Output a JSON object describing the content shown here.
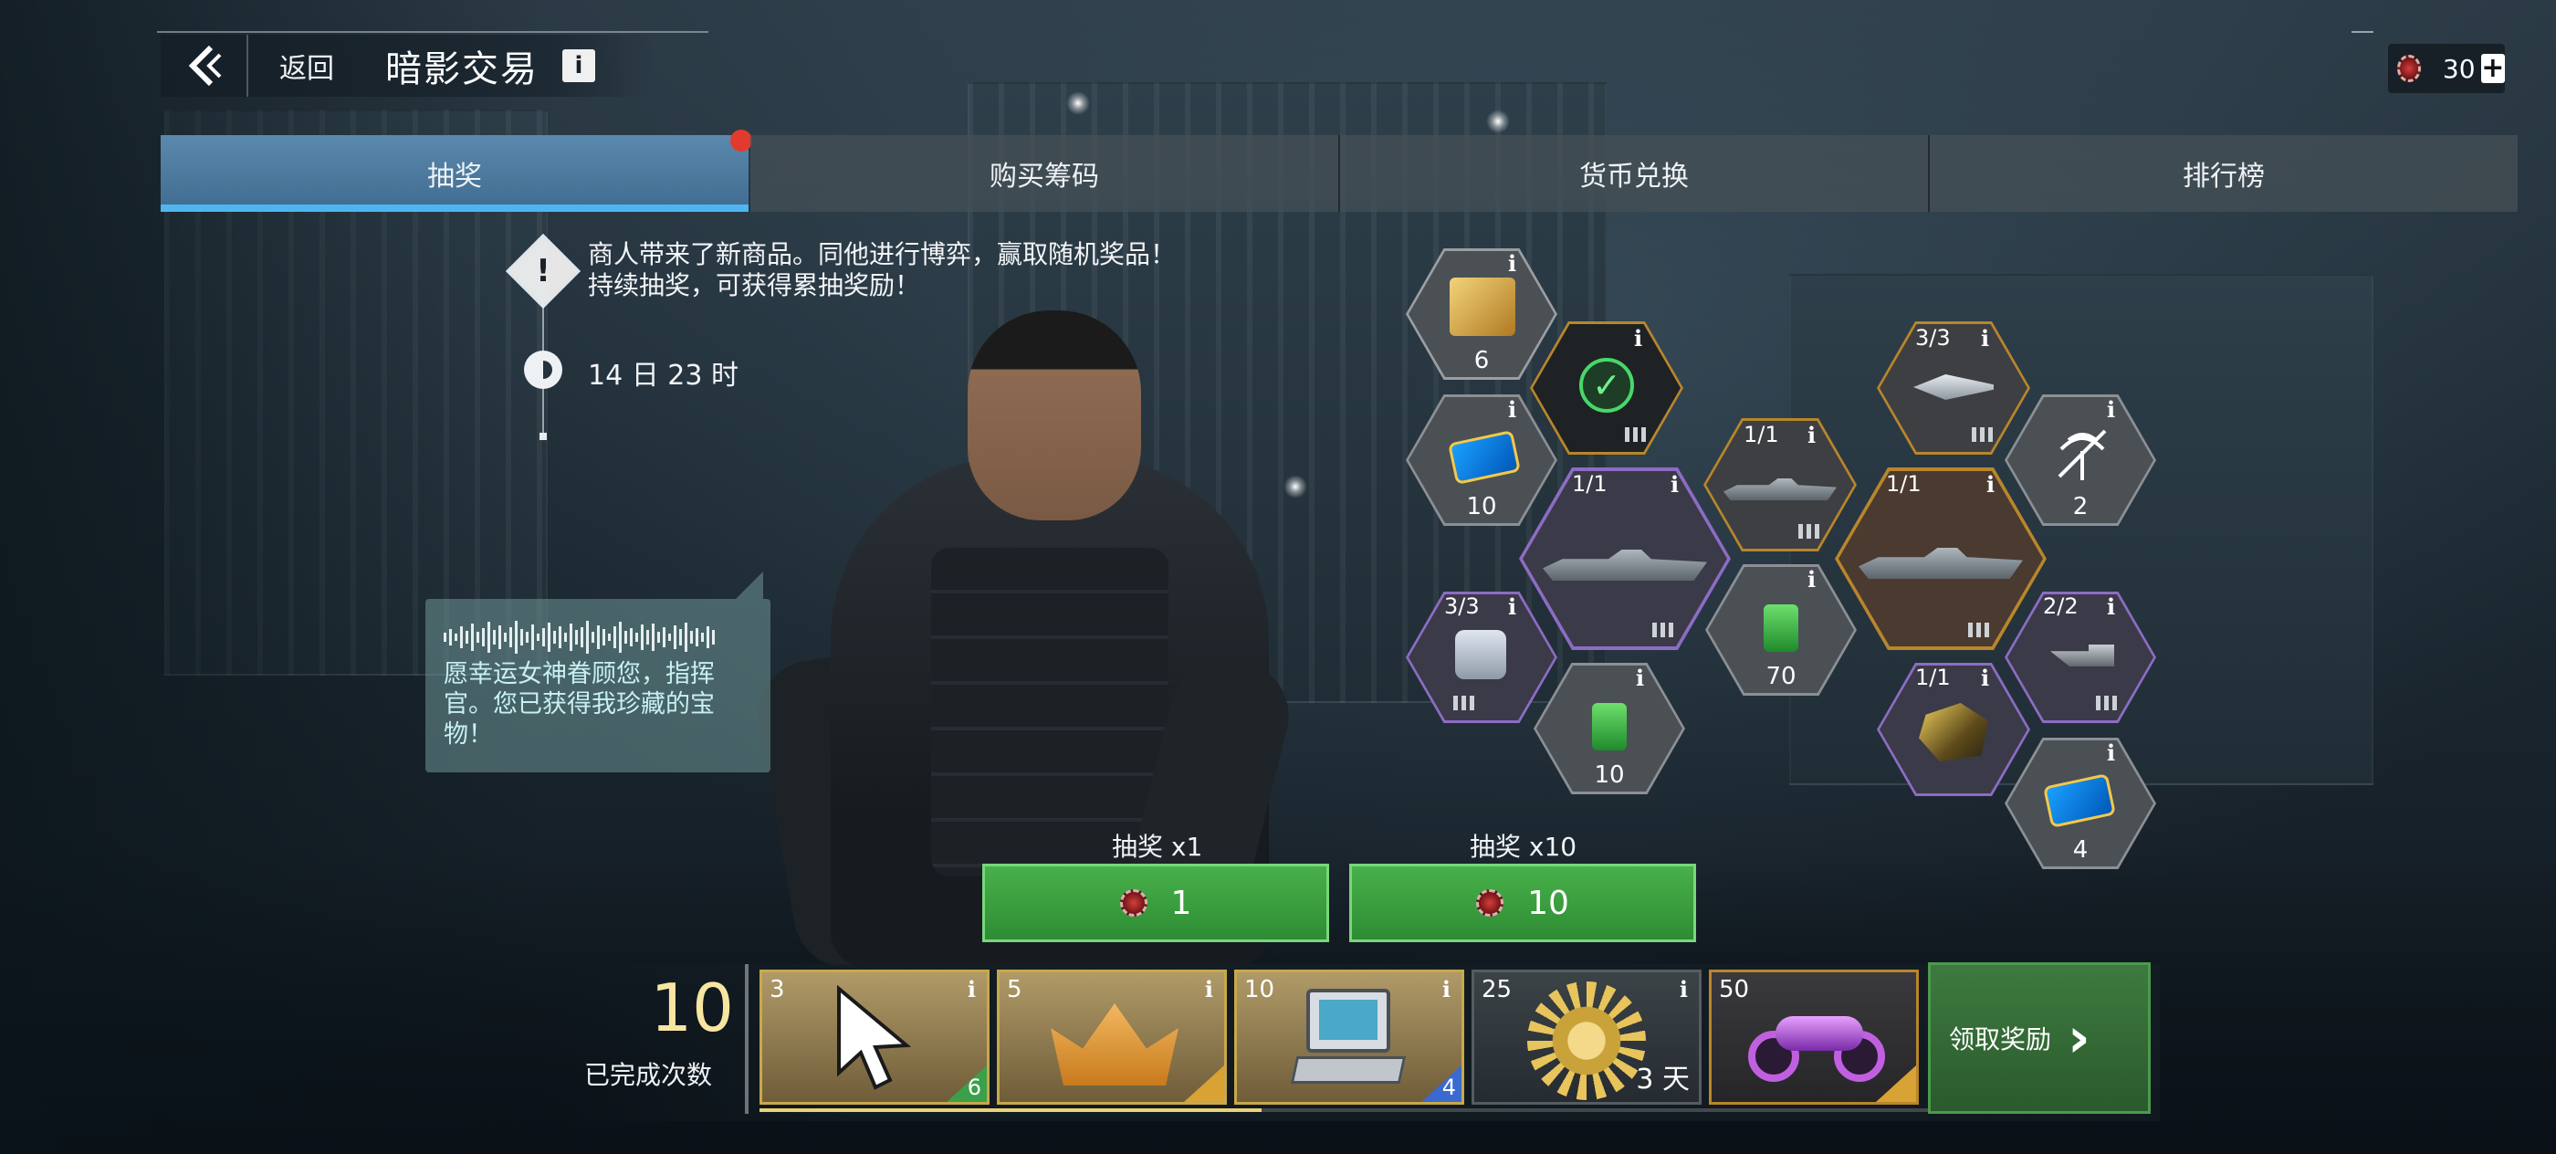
{
  "header": {
    "back_label": "返回",
    "title": "暗影交易",
    "info_glyph": "i",
    "currency_value": "30",
    "plus_glyph": "+"
  },
  "tabs": [
    {
      "label": "抽奖",
      "active": true,
      "badge": true
    },
    {
      "label": "购买筹码",
      "active": false
    },
    {
      "label": "货币兑换",
      "active": false
    },
    {
      "label": "排行榜",
      "active": false
    }
  ],
  "event": {
    "desc_line1": "商人带来了新商品。同他进行博弈，赢取随机奖品！",
    "desc_line2": "持续抽奖，可获得累抽奖励！",
    "timer": "14 日 23 时"
  },
  "speech": {
    "text": "愿幸运女神眷顾您，指挥官。您已获得我珍藏的宝物！"
  },
  "prizes": [
    {
      "id": "gear",
      "label": "6",
      "icon": "gear-crosshair-icon",
      "rarity": "gold"
    },
    {
      "id": "ship-claimed",
      "label": "",
      "icon": "check-icon",
      "rarity": "gold",
      "tier": "III",
      "claimed": true
    },
    {
      "id": "ticket-a",
      "label": "10",
      "icon": "ticket-icon",
      "rarity": "grey"
    },
    {
      "id": "ship-big-a",
      "tl": "1/1",
      "icon": "warship-icon",
      "rarity": "purple",
      "tier": "III"
    },
    {
      "id": "ship-mid",
      "tl": "1/1",
      "icon": "warship-icon",
      "rarity": "gold",
      "tier": "III"
    },
    {
      "id": "jet",
      "tl": "3/3",
      "icon": "aircraft-icon",
      "rarity": "gold",
      "tier": "III"
    },
    {
      "id": "signal",
      "label": "2",
      "icon": "signal-off-icon",
      "rarity": "grey"
    },
    {
      "id": "ship-big-b",
      "tl": "1/1",
      "icon": "warship-icon",
      "rarity": "gold",
      "tier": "III"
    },
    {
      "id": "module",
      "tl": "3/3",
      "icon": "module-icon",
      "rarity": "purple",
      "tier": "III"
    },
    {
      "id": "chip-70",
      "label": "70",
      "icon": "upgrade-chip-icon",
      "rarity": "grey"
    },
    {
      "id": "chip-10",
      "label": "10",
      "icon": "upgrade-chip-icon",
      "rarity": "grey"
    },
    {
      "id": "turret",
      "tl": "2/2",
      "icon": "turret-icon",
      "rarity": "purple",
      "tier": "III"
    },
    {
      "id": "ore",
      "tl": "1/1",
      "icon": "ore-icon",
      "rarity": "purple"
    },
    {
      "id": "ticket-b",
      "label": "4",
      "icon": "ticket-icon",
      "rarity": "grey"
    }
  ],
  "draw": {
    "single_label": "抽奖 x1",
    "single_cost": "1",
    "multi_label": "抽奖 x10",
    "multi_cost": "10"
  },
  "progress": {
    "completed": "10",
    "completed_label": "已完成次数",
    "fill_fraction": 0.43,
    "milestones": [
      {
        "threshold": "3",
        "icon": "cursor-icon",
        "qty": "6",
        "style": "gold",
        "corner": "#3aa14a"
      },
      {
        "threshold": "5",
        "icon": "crown-icon",
        "qty": "",
        "style": "gold",
        "corner": "#d9a234"
      },
      {
        "threshold": "10",
        "icon": "computer-icon",
        "qty": "4",
        "style": "gold",
        "corner": "#3a6ad0"
      },
      {
        "threshold": "25",
        "icon": "emblem-icon",
        "days": "3 天",
        "style": "dim"
      },
      {
        "threshold": "50",
        "icon": "motorcycle-icon",
        "qty": "",
        "style": "gold2",
        "corner": "#d9a234"
      }
    ],
    "claim_label": "领取奖励",
    "claim_glyph": "›"
  }
}
